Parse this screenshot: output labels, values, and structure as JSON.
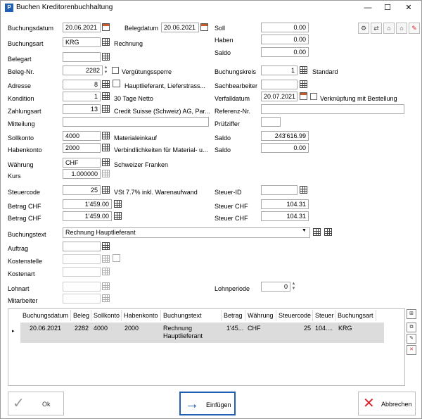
{
  "window": {
    "title": "Buchen Kreditorenbuchhaltung",
    "icon_letter": "P",
    "minimize": "—",
    "maximize": "☐",
    "close": "✕"
  },
  "form": {
    "buchungsdatum_label": "Buchungsdatum",
    "buchungsdatum": "20.06.2021",
    "belegdatum_label": "Belegdatum",
    "belegdatum": "20.06.2021",
    "buchungsart_label": "Buchungsart",
    "buchungsart": "KRG",
    "buchungsart_desc": "Rechnung",
    "belegart_label": "Belegart",
    "belegart": "",
    "belegnr_label": "Beleg-Nr.",
    "belegnr": "2282",
    "verguetungssperre_label": "Vergütungssperre",
    "adresse_label": "Adresse",
    "adresse": "8",
    "adresse_desc": "Hauptlieferant, Lieferstrass...",
    "kondition_label": "Kondition",
    "kondition": "1",
    "kondition_desc": "30 Tage Netto",
    "zahlungsart_label": "Zahlungsart",
    "zahlungsart": "13",
    "zahlungsart_desc": "Credit Suisse (Schweiz) AG, Par...",
    "mitteilung_label": "Mitteilung",
    "mitteilung": "",
    "sollkonto_label": "Sollkonto",
    "sollkonto": "4000",
    "sollkonto_desc": "Materialeinkauf",
    "habenkonto_label": "Habenkonto",
    "habenkonto": "2000",
    "habenkonto_desc": "Verbindlichkeiten für Material- u...",
    "waehrung_label": "Währung",
    "waehrung": "CHF",
    "waehrung_desc": "Schweizer Franken",
    "kurs_label": "Kurs",
    "kurs": "1.000000",
    "steuercode_label": "Steuercode",
    "steuercode": "25",
    "steuercode_desc": "VSt 7.7% inkl. Warenaufwand",
    "betrag1_label": "Betrag CHF",
    "betrag1": "1'459.00",
    "betrag2_label": "Betrag CHF",
    "betrag2": "1'459.00",
    "buchungstext_label": "Buchungstext",
    "buchungstext": "Rechnung Hauptlieferant",
    "auftrag_label": "Auftrag",
    "kostenstelle_label": "Kostenstelle",
    "kostenart_label": "Kostenart",
    "lohnart_label": "Lohnart",
    "mitarbeiter_label": "Mitarbeiter",
    "lohnperiode_label": "Lohnperiode",
    "lohnperiode": "0"
  },
  "right": {
    "soll_label": "Soll",
    "soll": "0.00",
    "haben_label": "Haben",
    "haben": "0.00",
    "saldo_label": "Saldo",
    "saldo": "0.00",
    "buchungskreis_label": "Buchungskreis",
    "buchungskreis": "1",
    "buchungskreis_desc": "Standard",
    "sachbearbeiter_label": "Sachbearbeiter",
    "sachbearbeiter": "",
    "verfalldatum_label": "Verfalldatum",
    "verfalldatum": "20.07.2021",
    "verknuepfung_label": "Verknüpfung mit Bestellung",
    "referenz_label": "Referenz-Nr.",
    "referenz": "",
    "pruefziffer_label": "Prüfziffer",
    "pruefziffer": "",
    "saldo2_label": "Saldo",
    "saldo2": "243'616.99",
    "saldo3_label": "Saldo",
    "saldo3": "0.00",
    "steuerid_label": "Steuer-ID",
    "steuerid": "",
    "steuer1_label": "Steuer CHF",
    "steuer1": "104.31",
    "steuer2_label": "Steuer CHF",
    "steuer2": "104.31"
  },
  "table": {
    "headers": [
      "Buchungsdatum",
      "Beleg",
      "Sollkonto",
      "Habenkonto",
      "Buchungstext",
      "Betrag",
      "Währung",
      "Steuercode",
      "Steuer",
      "Buchungsart"
    ],
    "row": {
      "buchungsdatum": "20.06.2021",
      "beleg": "2282",
      "sollkonto": "4000",
      "habenkonto": "2000",
      "buchungstext_1": "Rechnung",
      "buchungstext_2": "Hauptlieferant",
      "betrag": "1'45...",
      "waehrung": "CHF",
      "steuercode": "25",
      "steuer": "104....",
      "buchungsart": "KRG"
    },
    "row_marker": "▸"
  },
  "buttons": {
    "ok": "Ok",
    "einfuegen": "Einfügen",
    "abbrechen": "Abbrechen"
  },
  "colors": {
    "accent": "#1f5fb4",
    "close_red": "#d9252f",
    "row_selected": "#dcdcdc"
  }
}
